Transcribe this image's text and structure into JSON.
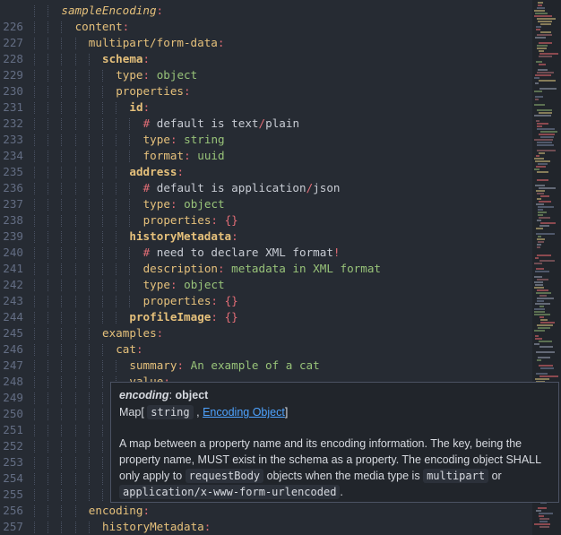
{
  "editor": {
    "lines": [
      {
        "num": "",
        "indent": 2,
        "tokens": [
          {
            "t": "sampleEncoding",
            "c": "key i"
          },
          {
            "t": ":",
            "c": "punct"
          }
        ]
      },
      {
        "num": "226",
        "indent": 3,
        "tokens": [
          {
            "t": "content",
            "c": "key"
          },
          {
            "t": ":",
            "c": "punct"
          }
        ]
      },
      {
        "num": "227",
        "indent": 4,
        "tokens": [
          {
            "t": "multipart/form-data",
            "c": "key"
          },
          {
            "t": ":",
            "c": "punct"
          }
        ]
      },
      {
        "num": "228",
        "indent": 5,
        "tokens": [
          {
            "t": "schema",
            "c": "key b"
          },
          {
            "t": ":",
            "c": "punct"
          }
        ]
      },
      {
        "num": "229",
        "indent": 6,
        "tokens": [
          {
            "t": "type",
            "c": "key"
          },
          {
            "t": ": ",
            "c": "punct"
          },
          {
            "t": "object",
            "c": "str"
          }
        ]
      },
      {
        "num": "230",
        "indent": 6,
        "tokens": [
          {
            "t": "properties",
            "c": "key"
          },
          {
            "t": ":",
            "c": "punct"
          }
        ]
      },
      {
        "num": "231",
        "indent": 7,
        "tokens": [
          {
            "t": "id",
            "c": "key b"
          },
          {
            "t": ":",
            "c": "punct"
          }
        ]
      },
      {
        "num": "232",
        "indent": 8,
        "tokens": [
          {
            "t": "#",
            "c": "punct"
          },
          {
            "t": " default is text",
            "c": "cmt"
          },
          {
            "t": "/",
            "c": "punct"
          },
          {
            "t": "plain",
            "c": "cmt"
          }
        ]
      },
      {
        "num": "233",
        "indent": 8,
        "tokens": [
          {
            "t": "type",
            "c": "key"
          },
          {
            "t": ": ",
            "c": "punct"
          },
          {
            "t": "string",
            "c": "str"
          }
        ]
      },
      {
        "num": "234",
        "indent": 8,
        "tokens": [
          {
            "t": "format",
            "c": "key"
          },
          {
            "t": ": ",
            "c": "punct"
          },
          {
            "t": "uuid",
            "c": "str"
          }
        ]
      },
      {
        "num": "235",
        "indent": 7,
        "tokens": [
          {
            "t": "address",
            "c": "key b"
          },
          {
            "t": ":",
            "c": "punct"
          }
        ]
      },
      {
        "num": "236",
        "indent": 8,
        "tokens": [
          {
            "t": "#",
            "c": "punct"
          },
          {
            "t": " default is application",
            "c": "cmt"
          },
          {
            "t": "/",
            "c": "punct"
          },
          {
            "t": "json",
            "c": "cmt"
          }
        ]
      },
      {
        "num": "237",
        "indent": 8,
        "tokens": [
          {
            "t": "type",
            "c": "key"
          },
          {
            "t": ": ",
            "c": "punct"
          },
          {
            "t": "object",
            "c": "str"
          }
        ]
      },
      {
        "num": "238",
        "indent": 8,
        "tokens": [
          {
            "t": "properties",
            "c": "key"
          },
          {
            "t": ": ",
            "c": "punct"
          },
          {
            "t": "{}",
            "c": "brace"
          }
        ]
      },
      {
        "num": "239",
        "indent": 7,
        "tokens": [
          {
            "t": "historyMetadata",
            "c": "key b"
          },
          {
            "t": ":",
            "c": "punct"
          }
        ]
      },
      {
        "num": "240",
        "indent": 8,
        "tokens": [
          {
            "t": "#",
            "c": "punct"
          },
          {
            "t": " need to declare XML format",
            "c": "cmt"
          },
          {
            "t": "!",
            "c": "punct"
          }
        ]
      },
      {
        "num": "241",
        "indent": 8,
        "tokens": [
          {
            "t": "description",
            "c": "key"
          },
          {
            "t": ": ",
            "c": "punct"
          },
          {
            "t": "metadata in XML format",
            "c": "str"
          }
        ]
      },
      {
        "num": "242",
        "indent": 8,
        "tokens": [
          {
            "t": "type",
            "c": "key"
          },
          {
            "t": ": ",
            "c": "punct"
          },
          {
            "t": "object",
            "c": "str"
          }
        ]
      },
      {
        "num": "243",
        "indent": 8,
        "tokens": [
          {
            "t": "properties",
            "c": "key"
          },
          {
            "t": ": ",
            "c": "punct"
          },
          {
            "t": "{}",
            "c": "brace"
          }
        ]
      },
      {
        "num": "244",
        "indent": 7,
        "tokens": [
          {
            "t": "profileImage",
            "c": "key b"
          },
          {
            "t": ": ",
            "c": "punct"
          },
          {
            "t": "{}",
            "c": "brace"
          }
        ]
      },
      {
        "num": "245",
        "indent": 5,
        "tokens": [
          {
            "t": "examples",
            "c": "key"
          },
          {
            "t": ":",
            "c": "punct"
          }
        ]
      },
      {
        "num": "246",
        "indent": 6,
        "tokens": [
          {
            "t": "cat",
            "c": "key"
          },
          {
            "t": ":",
            "c": "punct"
          }
        ]
      },
      {
        "num": "247",
        "indent": 7,
        "tokens": [
          {
            "t": "summary",
            "c": "key"
          },
          {
            "t": ": ",
            "c": "punct"
          },
          {
            "t": "An example of a cat",
            "c": "str"
          }
        ]
      },
      {
        "num": "248",
        "indent": 7,
        "tokens": [
          {
            "t": "value",
            "c": "key"
          },
          {
            "t": ":",
            "c": "punct"
          }
        ]
      },
      {
        "num": "249",
        "indent": 8,
        "tokens": []
      },
      {
        "num": "250",
        "indent": 8,
        "tokens": []
      },
      {
        "num": "251",
        "indent": 8,
        "tokens": []
      },
      {
        "num": "252",
        "indent": 8,
        "tokens": []
      },
      {
        "num": "253",
        "indent": 8,
        "tokens": []
      },
      {
        "num": "254",
        "indent": 8,
        "tokens": []
      },
      {
        "num": "255",
        "indent": 8,
        "tokens": []
      },
      {
        "num": "256",
        "indent": 4,
        "tokens": [
          {
            "t": "encoding",
            "c": "key"
          },
          {
            "t": ":",
            "c": "punct"
          }
        ]
      },
      {
        "num": "257",
        "indent": 5,
        "tokens": [
          {
            "t": "historyMetadata",
            "c": "key"
          },
          {
            "t": ":",
            "c": "punct"
          }
        ]
      }
    ]
  },
  "hover": {
    "name": "encoding",
    "sep": ": ",
    "type": "object",
    "map_prefix": "Map[",
    "map_key": "string",
    "map_comma": ",",
    "map_link": "Encoding Object",
    "map_suffix": "]",
    "desc_1": "A map between a property name and its encoding information. The key, being the property name, MUST exist in the schema as a property. The encoding object SHALL only apply to",
    "desc_code_1": "requestBody",
    "desc_2": "objects when the media type is",
    "desc_code_2": "multipart",
    "desc_3": "or",
    "desc_code_3": "application/x-www-form-urlencoded",
    "desc_4": "."
  },
  "colors": {
    "background": "#262b33",
    "key": "#e5c07b",
    "punct": "#e06c75",
    "string": "#98c379",
    "line_number": "#636d83",
    "link": "#4ea3ff"
  }
}
